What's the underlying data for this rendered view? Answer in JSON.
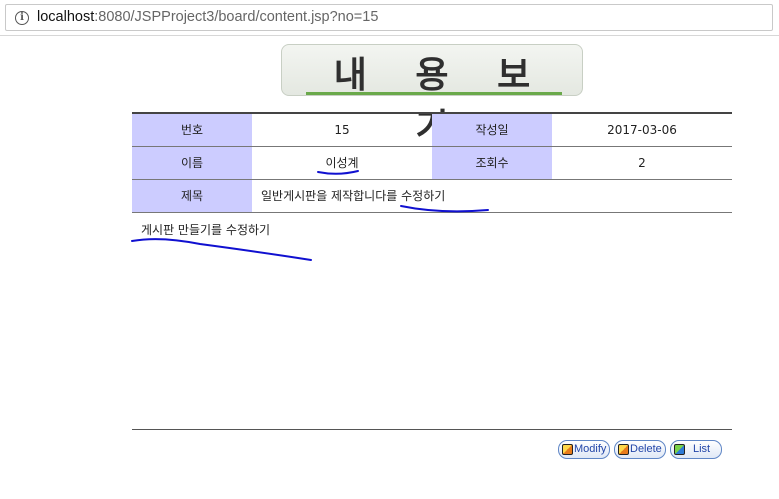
{
  "browser": {
    "url_host": "localhost",
    "url_rest": ":8080/JSPProject3/board/content.jsp?no=15"
  },
  "page": {
    "title": "내 용 보 기"
  },
  "article": {
    "no_label": "번호",
    "no_value": "15",
    "date_label": "작성일",
    "date_value": "2017-03-06",
    "name_label": "이름",
    "name_value": "이성계",
    "hits_label": "조회수",
    "hits_value": "2",
    "subject_label": "제목",
    "subject_value": "일반게시판을 제작합니다를 수정하기",
    "content": "게시판 만들기를 수정하기"
  },
  "buttons": {
    "modify": "Modify",
    "delete": "Delete",
    "list": "List"
  },
  "colors": {
    "header_cell": "#ccccff",
    "title_underline": "#6aa94a",
    "annotation_ink": "#1010d0"
  },
  "icons": [
    "info-icon",
    "modify-icon",
    "delete-icon",
    "list-icon"
  ]
}
